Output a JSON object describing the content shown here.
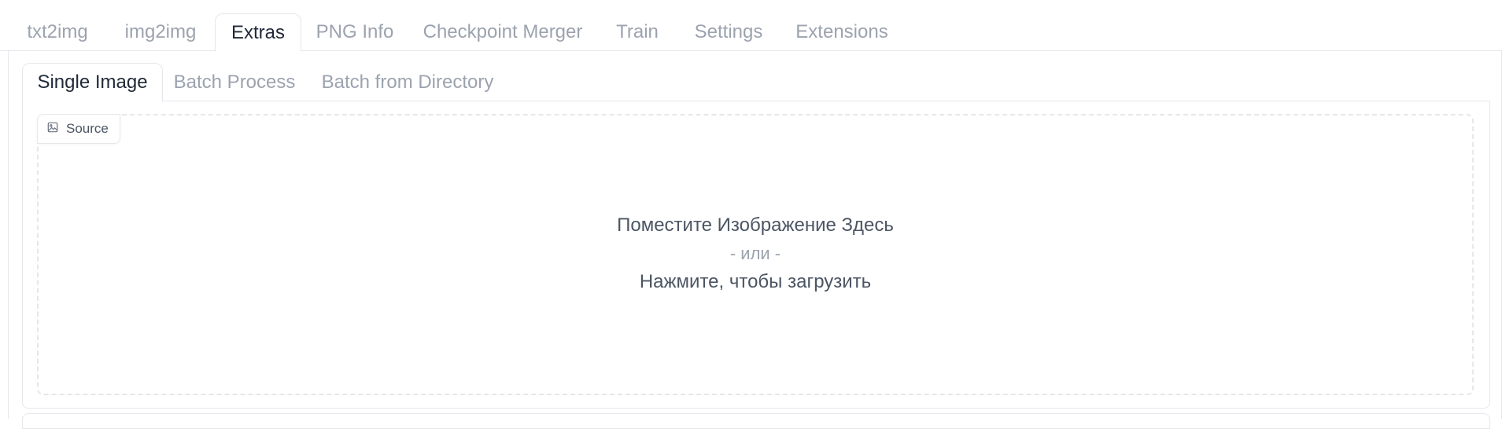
{
  "top_tabs": [
    {
      "label": "txt2img",
      "active": false
    },
    {
      "label": "img2img",
      "active": false
    },
    {
      "label": "Extras",
      "active": true
    },
    {
      "label": "PNG Info",
      "active": false
    },
    {
      "label": "Checkpoint Merger",
      "active": false
    },
    {
      "label": "Train",
      "active": false
    },
    {
      "label": "Settings",
      "active": false
    },
    {
      "label": "Extensions",
      "active": false
    }
  ],
  "sub_tabs": [
    {
      "label": "Single Image",
      "active": true
    },
    {
      "label": "Batch Process",
      "active": false
    },
    {
      "label": "Batch from Directory",
      "active": false
    }
  ],
  "source": {
    "label": "Source",
    "icon": "image-icon"
  },
  "dropzone": {
    "line1": "Поместите Изображение Здесь",
    "line2": "- или -",
    "line3": "Нажмите, чтобы загрузить"
  }
}
